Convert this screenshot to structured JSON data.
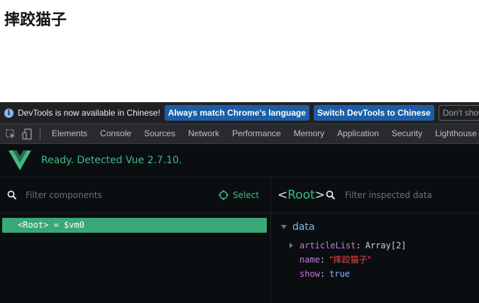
{
  "page": {
    "heading": "摔跤猫子"
  },
  "infobar": {
    "message": "DevTools is now available in Chinese!",
    "buttons": [
      "Always match Chrome's language",
      "Switch DevTools to Chinese",
      "Don't show again"
    ]
  },
  "devtools": {
    "tabs": [
      "Elements",
      "Console",
      "Sources",
      "Network",
      "Performance",
      "Memory",
      "Application",
      "Security",
      "Lighthouse"
    ]
  },
  "vue": {
    "status": "Ready. Detected Vue 2.7.10.",
    "components_filter_placeholder": "Filter components",
    "select_label": "Select",
    "tree": {
      "root_open": "<",
      "root_name": "Root",
      "root_close": ">",
      "root_alias": "= $vm0"
    },
    "inspector": {
      "title_open": "<",
      "title_name": "Root",
      "title_close": ">",
      "filter_placeholder": "Filter inspected data",
      "section": "data",
      "props": [
        {
          "key": "articleList",
          "value": "Array[2]"
        },
        {
          "key": "name",
          "value": "\"摔跤猫子\""
        },
        {
          "key": "show",
          "value": "true"
        }
      ]
    }
  },
  "colors": {
    "vue_green": "#42b883",
    "highlight": "#3ba776",
    "devtools_bg": "#202124",
    "panel_bg": "#0b0e11",
    "info_button": "#1b5ea6"
  },
  "icons": [
    "info-icon",
    "inspect-element-icon",
    "device-toolbar-icon",
    "vue-logo",
    "search-icon",
    "target-icon",
    "caret-down-icon",
    "caret-right-icon"
  ]
}
